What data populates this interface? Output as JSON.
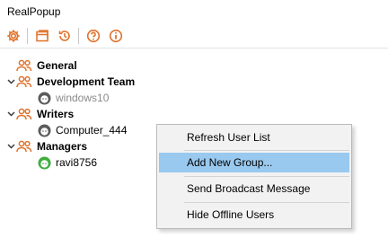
{
  "window": {
    "title": "RealPopup"
  },
  "colors": {
    "accent": "#e0722b",
    "online": "#3fae3f",
    "menu_highlight": "#99c9ef"
  },
  "toolbar": {
    "buttons": [
      {
        "icon": "gear-icon"
      },
      {
        "icon": "window-icon"
      },
      {
        "icon": "history-icon"
      },
      {
        "icon": "help-icon"
      },
      {
        "icon": "info-icon"
      }
    ]
  },
  "tree": {
    "groups": [
      {
        "label": "General",
        "expanded": false,
        "users": []
      },
      {
        "label": "Development Team",
        "expanded": true,
        "users": [
          {
            "name": "windows10",
            "status": "offline"
          }
        ]
      },
      {
        "label": "Writers",
        "expanded": true,
        "users": [
          {
            "name": "Computer_444",
            "status": "offline"
          }
        ]
      },
      {
        "label": "Managers",
        "expanded": true,
        "users": [
          {
            "name": "ravi8756",
            "status": "online"
          }
        ]
      }
    ]
  },
  "context_menu": {
    "items": [
      {
        "label": "Refresh User List",
        "highlighted": false
      },
      {
        "label": "Add New Group...",
        "highlighted": true
      },
      {
        "label": "Send Broadcast Message",
        "highlighted": false
      },
      {
        "label": "Hide Offline Users",
        "highlighted": false
      }
    ]
  }
}
